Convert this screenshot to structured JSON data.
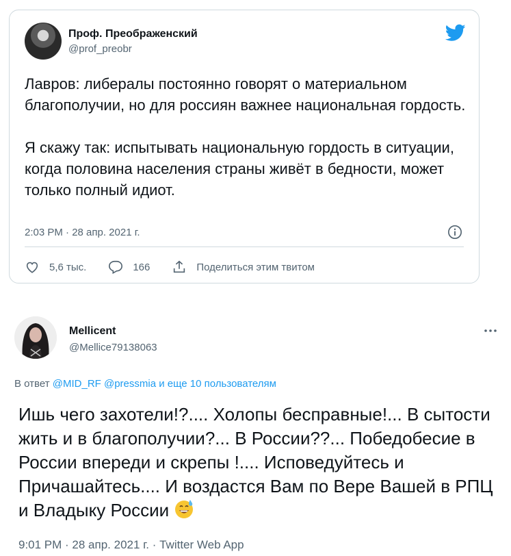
{
  "quoted_tweet": {
    "author_name": "Проф. Преображенский",
    "author_handle": "@prof_preobr",
    "paragraphs": [
      "Лавров: либералы постоянно говорят о материальном благополучии, но для россиян важнее национальная гордость.",
      "Я скажу так: испытывать национальную гордость в ситуации, когда половина населения страны живёт в бедности, может только полный идиот."
    ],
    "timestamp": "2:03 PM · 28 апр. 2021 г.",
    "likes_count": "5,6 тыс.",
    "replies_count": "166",
    "share_label": "Поделиться этим твитом"
  },
  "reply_tweet": {
    "author_name": "Mellicent",
    "author_handle": "@Mellice79138063",
    "replying_prefix": "В ответ",
    "replying_mentions": "@MID_RF @pressmia",
    "replying_suffix": "и еще 10 пользователям",
    "body_text": "Ишь чего захотели!?.... Холопы бесправные!... В сытости жить и в благополучии?... В России??... Победобесие в России впереди и скрепы !.... Исповедуйтесь и Причашайтесь.... И воздастся Вам по Вере Вашей в РПЦ и Владыку России",
    "timestamp": "9:01 PM · 28 апр. 2021 г. · Twitter Web App"
  },
  "icons": {
    "brand": "twitter-bird-icon",
    "info": "info-icon",
    "like": "heart-icon",
    "reply": "reply-bubble-icon",
    "share": "share-icon",
    "more": "more-dots-icon",
    "emoji": "grinning-sweat-emoji"
  },
  "colors": {
    "twitter_blue": "#1d9bf0",
    "secondary_text": "#536471",
    "border": "#cfd9de"
  }
}
